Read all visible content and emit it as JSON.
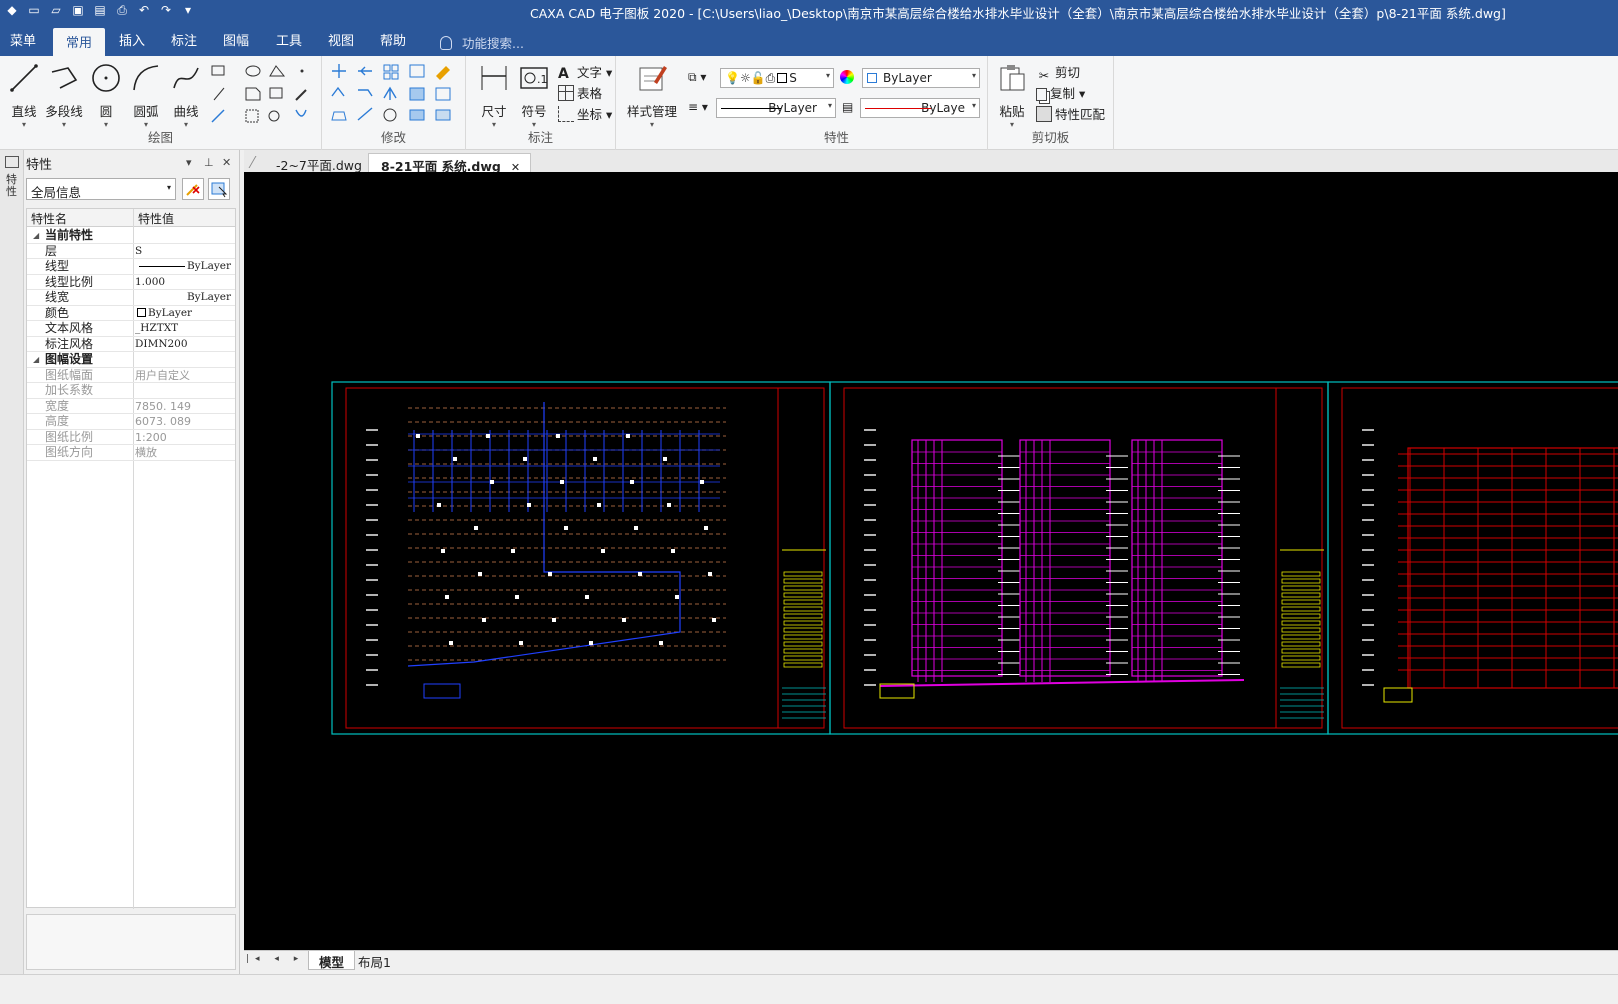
{
  "window": {
    "title": "CAXA CAD 电子图板 2020 - [C:\\Users\\liao_\\Desktop\\南京市某高层综合楼给水排水毕业设计（全套）\\南京市某高层综合楼给水排水毕业设计（全套）p\\8-21平面 系统.dwg]"
  },
  "quick_access": [
    "app-icon",
    "new-icon",
    "open-icon",
    "save-icon",
    "saveall-icon",
    "print-icon",
    "undo-icon",
    "redo-icon",
    "customize-icon"
  ],
  "ribbon_tabs": [
    {
      "label": "菜单"
    },
    {
      "label": "常用"
    },
    {
      "label": "插入"
    },
    {
      "label": "标注"
    },
    {
      "label": "图幅"
    },
    {
      "label": "工具"
    },
    {
      "label": "视图"
    },
    {
      "label": "帮助"
    }
  ],
  "search": {
    "label": "功能搜索..."
  },
  "groups": {
    "draw": {
      "label": "绘图",
      "line": "直线",
      "polyline": "多段线",
      "circle": "圆",
      "arc": "圆弧",
      "curve": "曲线"
    },
    "modify": {
      "label": "修改"
    },
    "annotate": {
      "label": "标注",
      "dimension": "尺寸",
      "symbol": "符号",
      "text": "文字",
      "table": "表格",
      "coordinate": "坐标"
    },
    "style": {
      "label": "样式管理"
    },
    "properties": {
      "label": "特性",
      "layer": "S",
      "color": "ByLayer",
      "linetype": "ByLayer",
      "lineweight": "ByLaye"
    },
    "clipboard": {
      "label": "剪切板",
      "paste": "粘贴",
      "cut": "剪切",
      "copy": "复制",
      "match": "特性匹配"
    }
  },
  "panel": {
    "title": "特性",
    "vertical_tab": "特性",
    "scope": "全局信息",
    "col_name": "特性名",
    "col_value": "特性值",
    "rows": [
      {
        "type": "cat",
        "name": "当前特性"
      },
      {
        "name": "层",
        "value": "S"
      },
      {
        "name": "线型",
        "value": "ByLayer",
        "line": true
      },
      {
        "name": "线型比例",
        "value": "1.000"
      },
      {
        "name": "线宽",
        "value": "ByLayer"
      },
      {
        "name": "颜色",
        "value": "ByLayer",
        "swatch": true
      },
      {
        "name": "文本风格",
        "value": "_HZTXT"
      },
      {
        "name": "标注风格",
        "value": "DIMN200"
      },
      {
        "type": "cat",
        "name": "图幅设置"
      },
      {
        "name": "图纸幅面",
        "value": "用户自定义",
        "disabled": true
      },
      {
        "name": "加长系数",
        "value": "",
        "disabled": true
      },
      {
        "name": "宽度",
        "value": "7850. 149",
        "disabled": true
      },
      {
        "name": "高度",
        "value": "6073. 089",
        "disabled": true
      },
      {
        "name": "图纸比例",
        "value": "1:200",
        "disabled": true
      },
      {
        "name": "图纸方向",
        "value": "横放",
        "disabled": true
      }
    ]
  },
  "doc_tabs": [
    {
      "label": "-2~7平面.dwg"
    },
    {
      "label": "8-21平面 系统.dwg",
      "active": true
    }
  ],
  "layout_tabs": [
    {
      "label": "模型",
      "active": true
    },
    {
      "label": "布局1"
    }
  ],
  "colors": {
    "ribbon_blue": "#2b579a",
    "canvas_bg": "#000000",
    "frame_cyan": "#00c0c0",
    "frame_red": "#d00000",
    "pipe_blue": "#2040ff",
    "pipe_magenta": "#e000e0",
    "title_yellow": "#e8e800"
  }
}
